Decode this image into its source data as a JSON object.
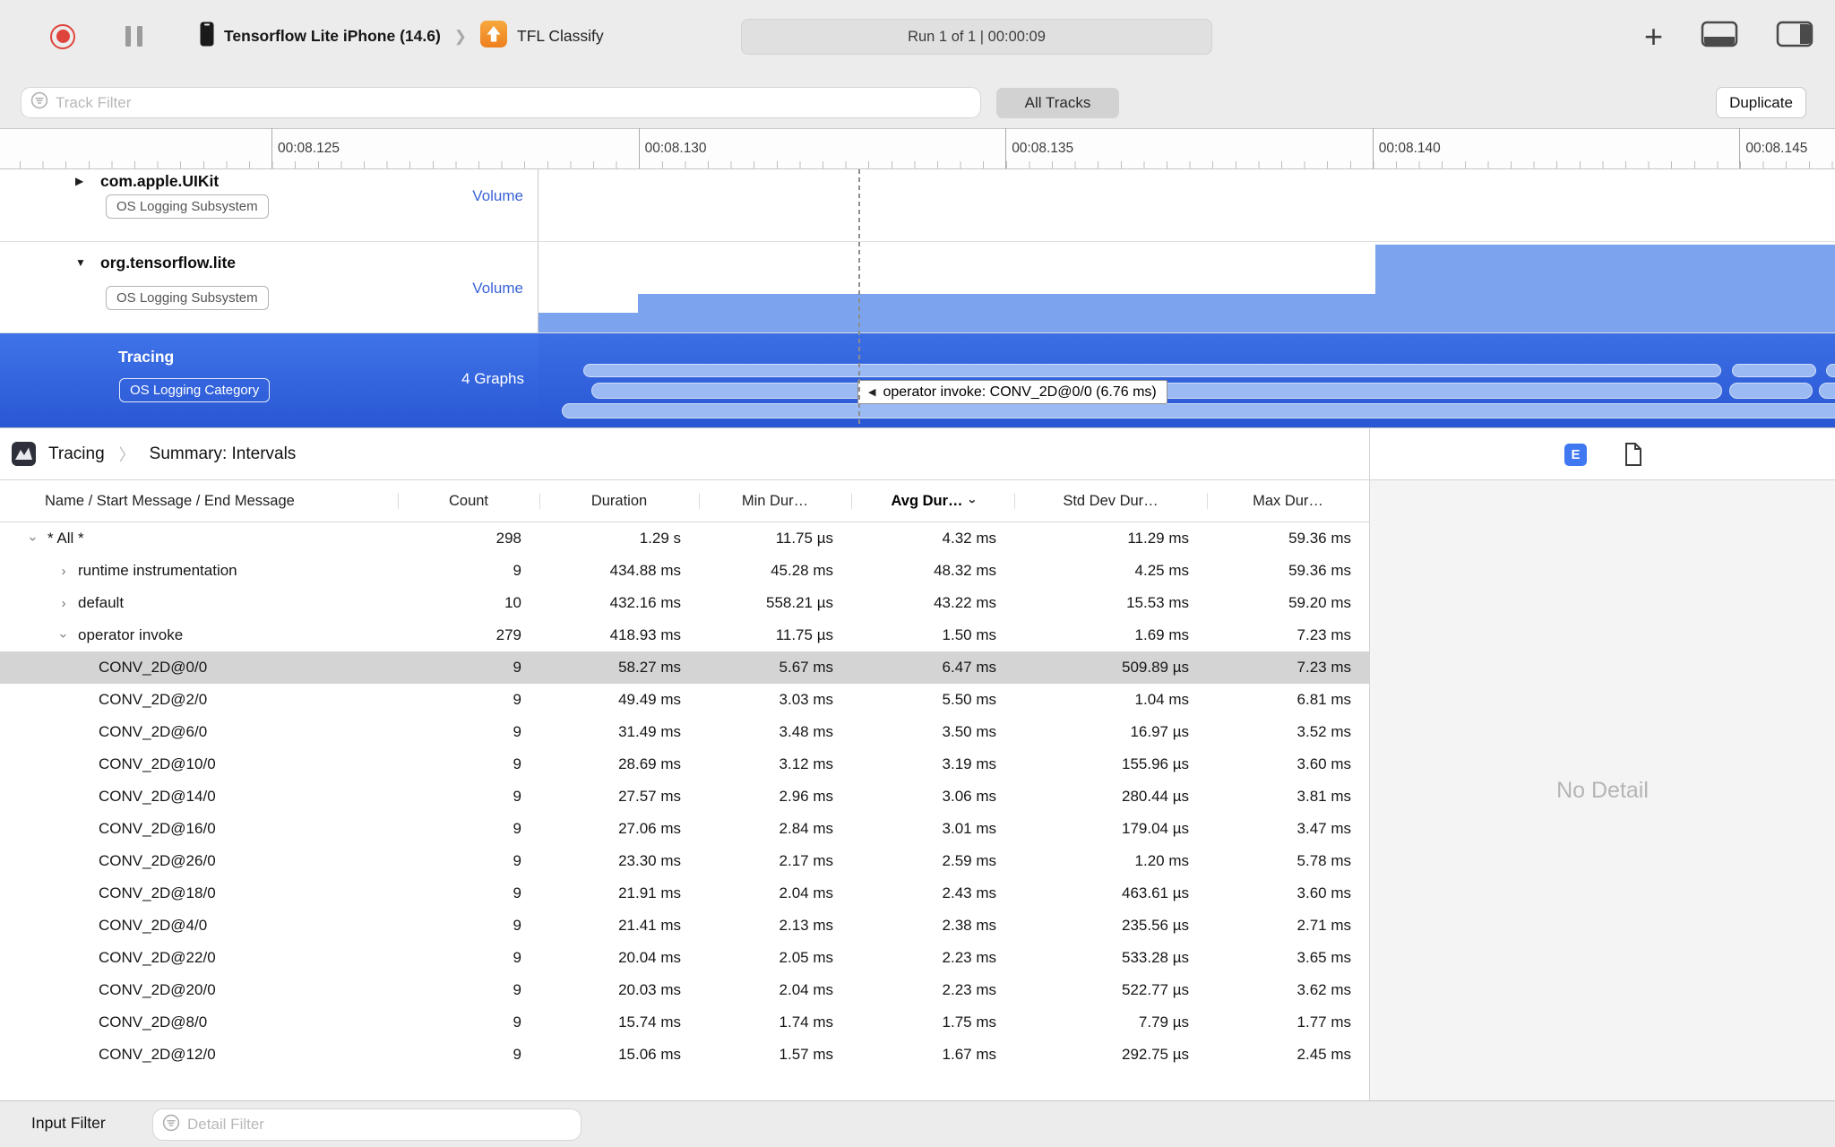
{
  "toolbar": {
    "device_name": "Tensorflow Lite iPhone (14.6)",
    "app_name": "TFL Classify",
    "run_status": "Run 1 of 1   |   00:00:09",
    "add_label": "+"
  },
  "filter_bar": {
    "track_filter_placeholder": "Track Filter",
    "all_tracks_label": "All Tracks",
    "duplicate_label": "Duplicate"
  },
  "ruler": {
    "labels": [
      "00:08.125",
      "00:08.130",
      "00:08.135",
      "00:08.140",
      "00:08.145"
    ]
  },
  "tracks": [
    {
      "name": "com.apple.UIKit",
      "badge": "OS Logging Subsystem",
      "meta": "Volume",
      "disclosure": "collapsed",
      "selected": false
    },
    {
      "name": "org.tensorflow.lite",
      "badge": "OS Logging Subsystem",
      "meta": "Volume",
      "disclosure": "expanded",
      "selected": false
    },
    {
      "name": "Tracing",
      "badge": "OS Logging Category",
      "meta": "4 Graphs",
      "disclosure": "none",
      "selected": true
    }
  ],
  "timeline": {
    "tooltip_text": "operator invoke: CONV_2D@0/0 (6.76 ms)"
  },
  "breadcrumb": {
    "root": "Tracing",
    "page": "Summary: Intervals"
  },
  "detail_header": {
    "extended_detail_label": "E"
  },
  "table": {
    "columns": [
      "Name / Start Message / End Message",
      "Count",
      "Duration",
      "Min Dur…",
      "Avg Dur…",
      "Std Dev Dur…",
      "Max Dur…"
    ],
    "sorted_column": "Avg Dur…",
    "rows": [
      {
        "name": "* All *",
        "indent": 0,
        "disclosure": "expanded",
        "selected": false,
        "count": "298",
        "duration": "1.29 s",
        "min": "11.75 µs",
        "avg": "4.32 ms",
        "std": "11.29 ms",
        "max": "59.36 ms"
      },
      {
        "name": "runtime instrumentation",
        "indent": 1,
        "disclosure": "collapsed",
        "selected": false,
        "count": "9",
        "duration": "434.88 ms",
        "min": "45.28 ms",
        "avg": "48.32 ms",
        "std": "4.25 ms",
        "max": "59.36 ms"
      },
      {
        "name": "default",
        "indent": 1,
        "disclosure": "collapsed",
        "selected": false,
        "count": "10",
        "duration": "432.16 ms",
        "min": "558.21 µs",
        "avg": "43.22 ms",
        "std": "15.53 ms",
        "max": "59.20 ms"
      },
      {
        "name": "operator invoke",
        "indent": 1,
        "disclosure": "expanded",
        "selected": false,
        "count": "279",
        "duration": "418.93 ms",
        "min": "11.75 µs",
        "avg": "1.50 ms",
        "std": "1.69 ms",
        "max": "7.23 ms"
      },
      {
        "name": "CONV_2D@0/0",
        "indent": 2,
        "disclosure": "none",
        "selected": true,
        "count": "9",
        "duration": "58.27 ms",
        "min": "5.67 ms",
        "avg": "6.47 ms",
        "std": "509.89 µs",
        "max": "7.23 ms"
      },
      {
        "name": "CONV_2D@2/0",
        "indent": 2,
        "disclosure": "none",
        "selected": false,
        "count": "9",
        "duration": "49.49 ms",
        "min": "3.03 ms",
        "avg": "5.50 ms",
        "std": "1.04 ms",
        "max": "6.81 ms"
      },
      {
        "name": "CONV_2D@6/0",
        "indent": 2,
        "disclosure": "none",
        "selected": false,
        "count": "9",
        "duration": "31.49 ms",
        "min": "3.48 ms",
        "avg": "3.50 ms",
        "std": "16.97 µs",
        "max": "3.52 ms"
      },
      {
        "name": "CONV_2D@10/0",
        "indent": 2,
        "disclosure": "none",
        "selected": false,
        "count": "9",
        "duration": "28.69 ms",
        "min": "3.12 ms",
        "avg": "3.19 ms",
        "std": "155.96 µs",
        "max": "3.60 ms"
      },
      {
        "name": "CONV_2D@14/0",
        "indent": 2,
        "disclosure": "none",
        "selected": false,
        "count": "9",
        "duration": "27.57 ms",
        "min": "2.96 ms",
        "avg": "3.06 ms",
        "std": "280.44 µs",
        "max": "3.81 ms"
      },
      {
        "name": "CONV_2D@16/0",
        "indent": 2,
        "disclosure": "none",
        "selected": false,
        "count": "9",
        "duration": "27.06 ms",
        "min": "2.84 ms",
        "avg": "3.01 ms",
        "std": "179.04 µs",
        "max": "3.47 ms"
      },
      {
        "name": "CONV_2D@26/0",
        "indent": 2,
        "disclosure": "none",
        "selected": false,
        "count": "9",
        "duration": "23.30 ms",
        "min": "2.17 ms",
        "avg": "2.59 ms",
        "std": "1.20 ms",
        "max": "5.78 ms"
      },
      {
        "name": "CONV_2D@18/0",
        "indent": 2,
        "disclosure": "none",
        "selected": false,
        "count": "9",
        "duration": "21.91 ms",
        "min": "2.04 ms",
        "avg": "2.43 ms",
        "std": "463.61 µs",
        "max": "3.60 ms"
      },
      {
        "name": "CONV_2D@4/0",
        "indent": 2,
        "disclosure": "none",
        "selected": false,
        "count": "9",
        "duration": "21.41 ms",
        "min": "2.13 ms",
        "avg": "2.38 ms",
        "std": "235.56 µs",
        "max": "2.71 ms"
      },
      {
        "name": "CONV_2D@22/0",
        "indent": 2,
        "disclosure": "none",
        "selected": false,
        "count": "9",
        "duration": "20.04 ms",
        "min": "2.05 ms",
        "avg": "2.23 ms",
        "std": "533.28 µs",
        "max": "3.65 ms"
      },
      {
        "name": "CONV_2D@20/0",
        "indent": 2,
        "disclosure": "none",
        "selected": false,
        "count": "9",
        "duration": "20.03 ms",
        "min": "2.04 ms",
        "avg": "2.23 ms",
        "std": "522.77 µs",
        "max": "3.62 ms"
      },
      {
        "name": "CONV_2D@8/0",
        "indent": 2,
        "disclosure": "none",
        "selected": false,
        "count": "9",
        "duration": "15.74 ms",
        "min": "1.74 ms",
        "avg": "1.75 ms",
        "std": "7.79 µs",
        "max": "1.77 ms"
      },
      {
        "name": "CONV_2D@12/0",
        "indent": 2,
        "disclosure": "none",
        "selected": false,
        "count": "9",
        "duration": "15.06 ms",
        "min": "1.57 ms",
        "avg": "1.67 ms",
        "std": "292.75 µs",
        "max": "2.45 ms"
      }
    ]
  },
  "detail_panel": {
    "empty_text": "No Detail"
  },
  "bottom_bar": {
    "input_filter_label": "Input Filter",
    "detail_filter_placeholder": "Detail Filter"
  }
}
